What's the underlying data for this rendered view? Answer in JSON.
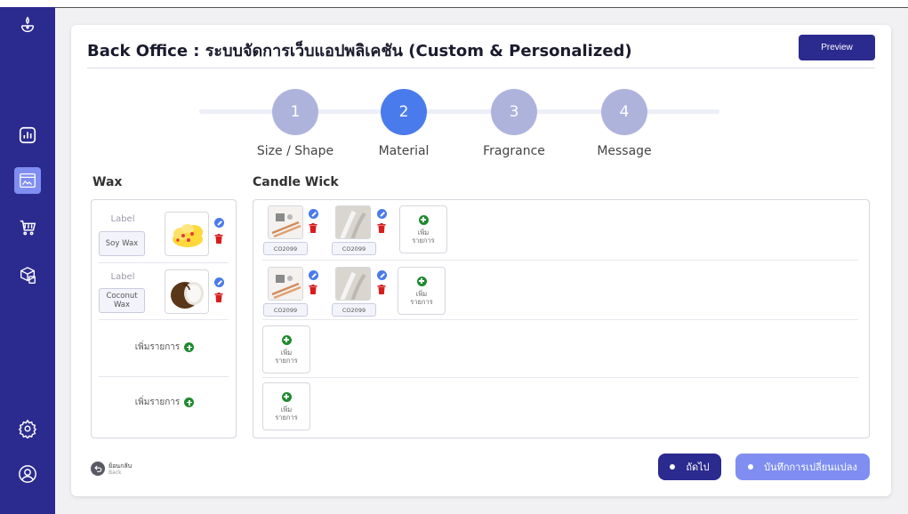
{
  "header": {
    "title": "Back Office : ระบบจัดการเว็บแอปพลิเคชัน (Custom & Personalized)",
    "preview_label": "Preview"
  },
  "steps": [
    {
      "number": "1",
      "label": "Size / Shape",
      "active": false
    },
    {
      "number": "2",
      "label": "Material",
      "active": true
    },
    {
      "number": "3",
      "label": "Fragrance",
      "active": false
    },
    {
      "number": "4",
      "label": "Message",
      "active": false
    }
  ],
  "wax": {
    "title": "Wax",
    "items": [
      {
        "label": "Label",
        "name": "Soy Wax"
      },
      {
        "label": "Label",
        "name": "Coconut Wax"
      }
    ],
    "add_label": "เพิ่มรายการ"
  },
  "wick": {
    "title": "Candle Wick",
    "rows": [
      {
        "items": [
          {
            "code": "CO2099"
          },
          {
            "code": "CO2099"
          }
        ],
        "add_label": "เพิ่ม รายการ"
      },
      {
        "items": [
          {
            "code": "CO2099"
          },
          {
            "code": "CO2099"
          }
        ],
        "add_label": "เพิ่ม รายการ"
      },
      {
        "items": [],
        "add_label": "เพิ่ม รายการ"
      },
      {
        "items": [],
        "add_label": "เพิ่ม รายการ"
      }
    ]
  },
  "footer": {
    "back_label": "ย้อนกลับ",
    "back_sub": "Back",
    "next_label": "ถัดไป",
    "save_label": "บันทึกการเปลี่ยนแปลง"
  },
  "colors": {
    "sidebar": "#2b2a8f",
    "accent": "#4a7bec",
    "step_inactive": "#aeb3dc",
    "add_green": "#1f8a2e",
    "delete_red": "#d81d1d"
  }
}
